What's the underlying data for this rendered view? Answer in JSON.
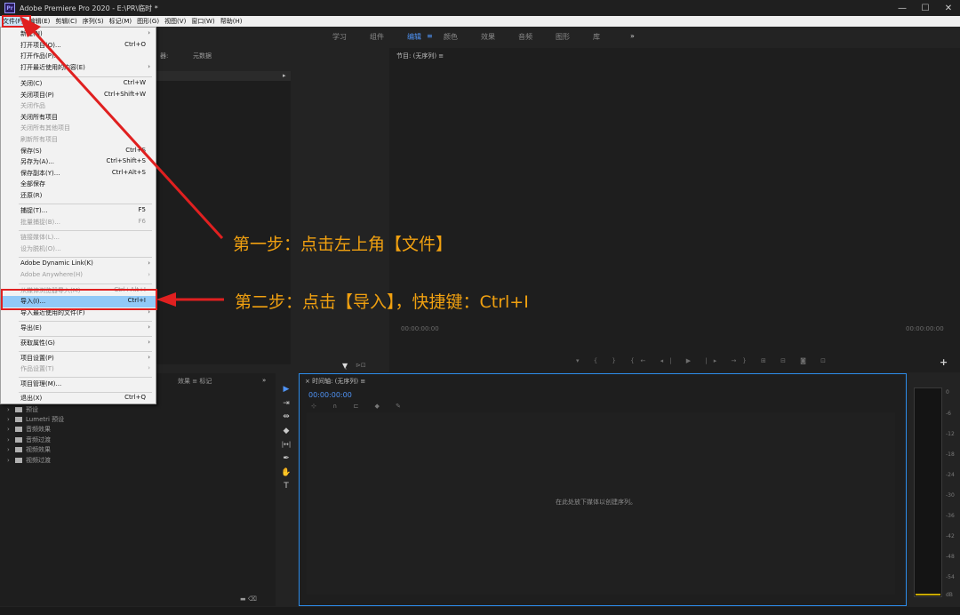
{
  "window": {
    "title": "Adobe Premiere Pro 2020 - E:\\PR\\临时 *",
    "icon_text": "Pr",
    "controls": [
      "—",
      "☐",
      "✕"
    ]
  },
  "menubar": {
    "items": [
      "文件(F)",
      "编辑(E)",
      "剪辑(C)",
      "序列(S)",
      "标记(M)",
      "图形(G)",
      "视图(V)",
      "窗口(W)",
      "帮助(H)"
    ]
  },
  "workspace": {
    "tabs": [
      "学习",
      "组件",
      "编辑",
      "颜色",
      "效果",
      "音频",
      "图形",
      "库"
    ],
    "active": "编辑",
    "more": "»",
    "menu_glyph": "≡"
  },
  "source_panel": {
    "tabs": [
      "器:",
      "元数据"
    ]
  },
  "program_panel": {
    "title": "节目: (无序列) ≡",
    "timecode_left": "00:00:00:00",
    "timecode_right": "00:00:00:00",
    "transport": "▾ { } {← ◂| ▶ |▸ →} ⊞ ⊟ ◙ ⊡",
    "add_button": "+"
  },
  "effects_panel": {
    "tabs": "效果 ≡  标记",
    "more": "»",
    "items": [
      "预设",
      "Lumetri 预设",
      "音频效果",
      "音频过渡",
      "视频效果",
      "视频过渡"
    ]
  },
  "tools": [
    "▶",
    "⇥",
    "⇹",
    "◆",
    "|↔|",
    "✒",
    "✋",
    "T"
  ],
  "timeline": {
    "title": "×  时间轴: (无序列) ≡",
    "timecode": "00:00:00:00",
    "icons": "⊹ ∩ ⊏ ◆ ✎",
    "hint": "在此处放下媒体以创建序列。"
  },
  "audio_meter": {
    "ticks": [
      "0",
      "-6",
      "-12",
      "-18",
      "-24",
      "-30",
      "-36",
      "-42",
      "-48",
      "-54",
      "dB"
    ]
  },
  "file_menu": {
    "items": [
      {
        "label": "新建(N)",
        "shortcut": "",
        "arrow": "›",
        "disabled": false
      },
      {
        "label": "打开项目(O)...",
        "shortcut": "Ctrl+O",
        "arrow": "",
        "disabled": false
      },
      {
        "label": "打开作品(P)...",
        "shortcut": "",
        "arrow": "",
        "disabled": false
      },
      {
        "label": "打开最近使用的内容(E)",
        "shortcut": "",
        "arrow": "›",
        "disabled": false
      },
      {
        "label": "关闭(C)",
        "shortcut": "Ctrl+W",
        "arrow": "",
        "disabled": false
      },
      {
        "label": "关闭项目(P)",
        "shortcut": "Ctrl+Shift+W",
        "arrow": "",
        "disabled": false
      },
      {
        "label": "关闭作品",
        "shortcut": "",
        "arrow": "",
        "disabled": true
      },
      {
        "label": "关闭所有项目",
        "shortcut": "",
        "arrow": "",
        "disabled": false
      },
      {
        "label": "关闭所有其他项目",
        "shortcut": "",
        "arrow": "",
        "disabled": true
      },
      {
        "label": "刷新所有项目",
        "shortcut": "",
        "arrow": "",
        "disabled": true
      },
      {
        "label": "保存(S)",
        "shortcut": "Ctrl+S",
        "arrow": "",
        "disabled": false
      },
      {
        "label": "另存为(A)...",
        "shortcut": "Ctrl+Shift+S",
        "arrow": "",
        "disabled": false
      },
      {
        "label": "保存副本(Y)...",
        "shortcut": "Ctrl+Alt+S",
        "arrow": "",
        "disabled": false
      },
      {
        "label": "全部保存",
        "shortcut": "",
        "arrow": "",
        "disabled": false
      },
      {
        "label": "还原(R)",
        "shortcut": "",
        "arrow": "",
        "disabled": false
      },
      {
        "label": "捕捉(T)...",
        "shortcut": "F5",
        "arrow": "",
        "disabled": false
      },
      {
        "label": "批量捕捉(B)...",
        "shortcut": "F6",
        "arrow": "",
        "disabled": true
      },
      {
        "label": "链接媒体(L)...",
        "shortcut": "",
        "arrow": "",
        "disabled": true
      },
      {
        "label": "设为脱机(O)...",
        "shortcut": "",
        "arrow": "",
        "disabled": true
      },
      {
        "label": "Adobe Dynamic Link(K)",
        "shortcut": "",
        "arrow": "›",
        "disabled": false
      },
      {
        "label": "Adobe Anywhere(H)",
        "shortcut": "",
        "arrow": "›",
        "disabled": true
      },
      {
        "label": "从媒体浏览器导入(M)",
        "shortcut": "Ctrl+Alt+I",
        "arrow": "",
        "disabled": true
      },
      {
        "label": "导入(I)...",
        "shortcut": "Ctrl+I",
        "arrow": "",
        "disabled": false
      },
      {
        "label": "导入最近使用的文件(F)",
        "shortcut": "",
        "arrow": "›",
        "disabled": false
      },
      {
        "label": "导出(E)",
        "shortcut": "",
        "arrow": "›",
        "disabled": false
      },
      {
        "label": "获取属性(G)",
        "shortcut": "",
        "arrow": "›",
        "disabled": false
      },
      {
        "label": "项目设置(P)",
        "shortcut": "",
        "arrow": "›",
        "disabled": false
      },
      {
        "label": "作品设置(T)",
        "shortcut": "",
        "arrow": "›",
        "disabled": true
      },
      {
        "label": "项目管理(M)...",
        "shortcut": "",
        "arrow": "",
        "disabled": false
      },
      {
        "label": "退出(X)",
        "shortcut": "Ctrl+Q",
        "arrow": "",
        "disabled": false
      }
    ]
  },
  "annotations": {
    "step1": "第一步：点击左上角【文件】",
    "step2": "第二步：点击【导入】，快捷键：Ctrl+I",
    "color_text": "#f0a010",
    "color_arrow": "#e02020"
  }
}
